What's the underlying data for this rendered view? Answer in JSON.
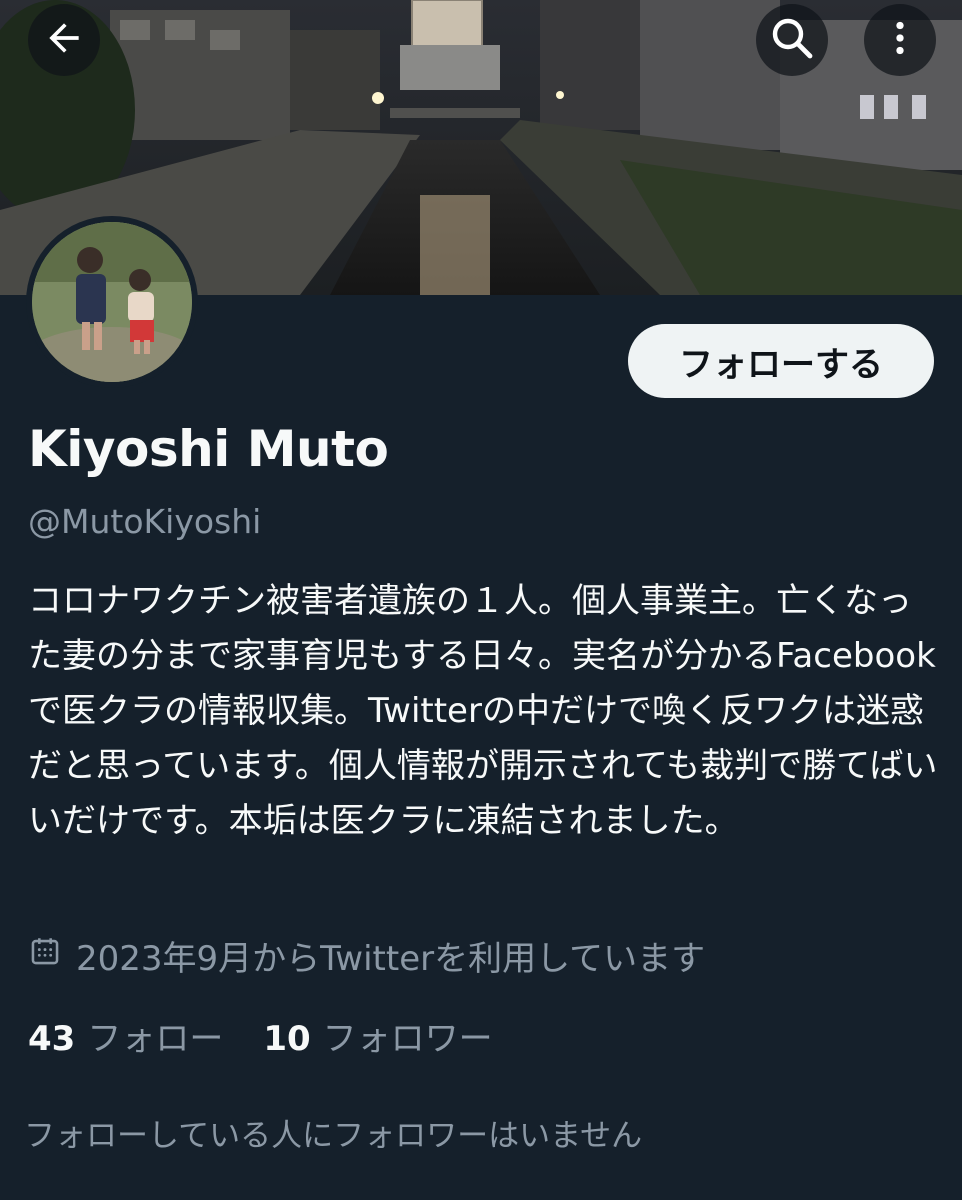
{
  "profile": {
    "display_name": "Kiyoshi Muto",
    "handle": "@MutoKiyoshi",
    "bio": "コロナワクチン被害者遺族の１人。個人事業主。亡くなった妻の分まで家事育児もする日々。実名が分かるFacebookで医クラの情報収集。Twitterの中だけで喚く反ワクは迷惑だと思っています。個人情報が開示されても裁判で勝てばいいだけです。本垢は医クラに凍結されました。",
    "joined": "2023年9月からTwitterを利用しています",
    "following_count": "43",
    "following_label": "フォロー",
    "followers_count": "10",
    "followers_label": "フォロワー",
    "mutual_note": "フォローしている人にフォロワーはいません"
  },
  "actions": {
    "follow_label": "フォローする"
  },
  "icons": {
    "back": "arrow-left-icon",
    "search": "search-icon",
    "more": "more-vertical-icon",
    "calendar": "calendar-icon"
  },
  "colors": {
    "background": "#15202b",
    "primary_text": "#f7f9f9",
    "secondary_text": "#8b98a5",
    "follow_button_bg": "#eff3f4",
    "follow_button_text": "#0f1419"
  }
}
